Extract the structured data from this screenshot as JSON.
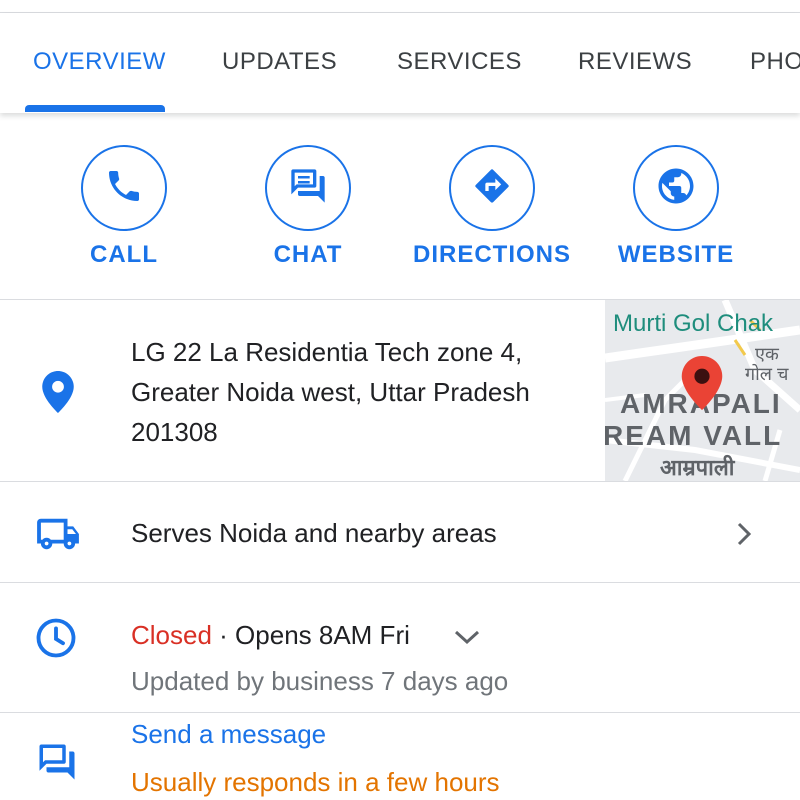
{
  "tabs": [
    {
      "label": "OVERVIEW",
      "active": true
    },
    {
      "label": "UPDATES",
      "active": false
    },
    {
      "label": "SERVICES",
      "active": false
    },
    {
      "label": "REVIEWS",
      "active": false
    },
    {
      "label": "PHO",
      "active": false
    }
  ],
  "actions": [
    {
      "label": "CALL",
      "icon": "phone-icon"
    },
    {
      "label": "CHAT",
      "icon": "chat-icon"
    },
    {
      "label": "DIRECTIONS",
      "icon": "directions-icon"
    },
    {
      "label": "WEBSITE",
      "icon": "globe-icon"
    }
  ],
  "address": {
    "icon": "location-pin-icon",
    "lines": [
      "LG 22 La Residentia Tech zone 4,",
      "Greater Noida west, Uttar Pradesh",
      "201308"
    ]
  },
  "map": {
    "labels": [
      "Murti Gol Chak",
      "एक",
      "गोल च",
      "AMRAPALI",
      "REAM VALL",
      "आम्रपाली"
    ]
  },
  "service_area": {
    "icon": "truck-icon",
    "text": "Serves Noida and nearby areas"
  },
  "hours": {
    "icon": "clock-icon",
    "status": "Closed",
    "separator": " · ",
    "opens": "Opens 8AM Fri",
    "updated": "Updated by business 7 days ago"
  },
  "message": {
    "icon": "message-icon",
    "link": "Send a message",
    "note": "Usually responds in a few hours"
  },
  "colors": {
    "accent": "#1a73e8",
    "closed": "#d93025",
    "response_note": "#e37400",
    "pin": "#ea4335"
  }
}
